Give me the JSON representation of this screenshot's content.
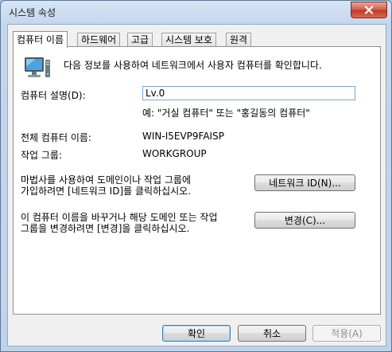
{
  "window": {
    "title": "시스템 속성"
  },
  "tabs": [
    {
      "label": "컴퓨터 이름"
    },
    {
      "label": "하드웨어"
    },
    {
      "label": "고급"
    },
    {
      "label": "시스템 보호"
    },
    {
      "label": "원격"
    }
  ],
  "panel": {
    "intro": "다음 정보를 사용하여 네트워크에서 사용자 컴퓨터를 확인합니다.",
    "description_label": "컴퓨터 설명(D):",
    "description_value": "Lv.0",
    "description_example": "예: \"거실 컴퓨터\" 또는 \"홍길동의 컴퓨터\"",
    "full_name_label": "전체 컴퓨터 이름:",
    "full_name_value": "WIN-I5EVP9FAISP",
    "workgroup_label": "작업 그룹:",
    "workgroup_value": "WORKGROUP",
    "network_id_line1": "마법사를 사용하여 도메인이나 작업 그룹에",
    "network_id_line2": "가입하려면 [네트워크 ID]를 클릭하십시오.",
    "network_id_button": "네트워크 ID(N)...",
    "change_line1": "이 컴퓨터 이름을 바꾸거나 해당 도메인 또는 작업",
    "change_line2": "그룹을 변경하려면 [변경]을 클릭하십시오.",
    "change_button": "변경(C)..."
  },
  "footer": {
    "ok": "확인",
    "cancel": "취소",
    "apply": "적용(A)"
  }
}
